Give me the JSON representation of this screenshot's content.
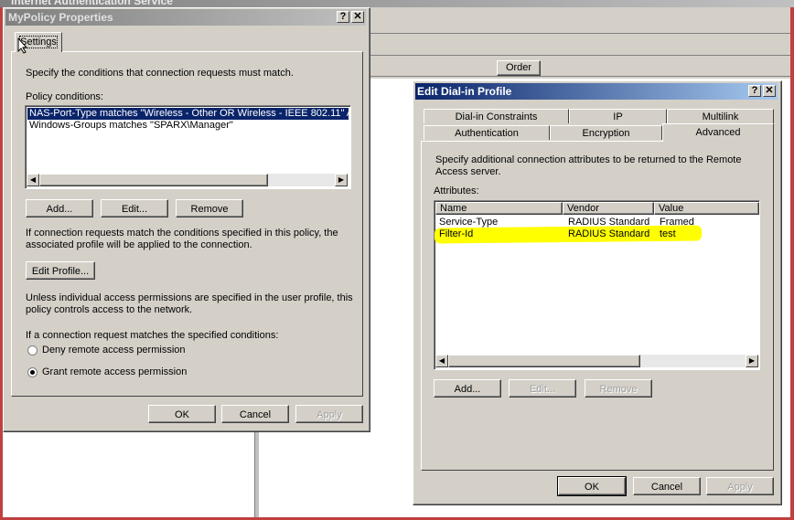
{
  "background": {
    "title": "Internet Authentication Service",
    "order_header": "Order"
  },
  "policy_dialog": {
    "title": "MyPolicy Properties",
    "help_btn": "?",
    "close_btn": "✕",
    "tab_settings": "Settings",
    "instruction": "Specify the conditions that connection requests must match.",
    "conditions_label": "Policy conditions:",
    "conditions": [
      "NAS-Port-Type matches \"Wireless - Other OR Wireless - IEEE 802.11\" AN",
      "Windows-Groups matches \"SPARX\\Manager\""
    ],
    "add_btn": "Add...",
    "edit_btn": "Edit...",
    "remove_btn": "Remove",
    "profile_text_1": "If connection requests match the conditions specified in this policy, the",
    "profile_text_2": "associated profile will be applied to the connection.",
    "edit_profile_btn": "Edit Profile...",
    "permission_text_1": "Unless individual access permissions are specified in the user profile, this",
    "permission_text_2": "policy controls access to the network.",
    "match_text": "If a connection request matches the specified conditions:",
    "deny_label": "Deny remote access permission",
    "grant_label": "Grant remote access permission",
    "ok_btn": "OK",
    "cancel_btn": "Cancel",
    "apply_btn": "Apply"
  },
  "dialin_dialog": {
    "title": "Edit Dial-in Profile",
    "help_btn": "?",
    "close_btn": "✕",
    "tabs_row1": [
      "Dial-in Constraints",
      "IP",
      "Multilink"
    ],
    "tabs_row2": [
      "Authentication",
      "Encryption",
      "Advanced"
    ],
    "desc_1": "Specify additional connection attributes to be returned to the Remote",
    "desc_2": "Access server.",
    "attributes_label": "Attributes:",
    "columns": [
      "Name",
      "Vendor",
      "Value"
    ],
    "rows": [
      {
        "name": "Service-Type",
        "vendor": "RADIUS Standard",
        "value": "Framed"
      },
      {
        "name": "Filter-Id",
        "vendor": "RADIUS Standard",
        "value": "test"
      }
    ],
    "highlight_color": "#ffff00",
    "add_btn": "Add...",
    "edit_btn": "Edit...",
    "remove_btn": "Remove",
    "ok_btn": "OK",
    "cancel_btn": "Cancel",
    "apply_btn": "Apply"
  },
  "colors": {
    "dialog_face": "#d4d0c8",
    "title_active_start": "#0a246a",
    "title_active_end": "#a6caf0",
    "title_inactive_start": "#808080",
    "title_inactive_end": "#c0c0c0",
    "selection": "#0a246a"
  }
}
